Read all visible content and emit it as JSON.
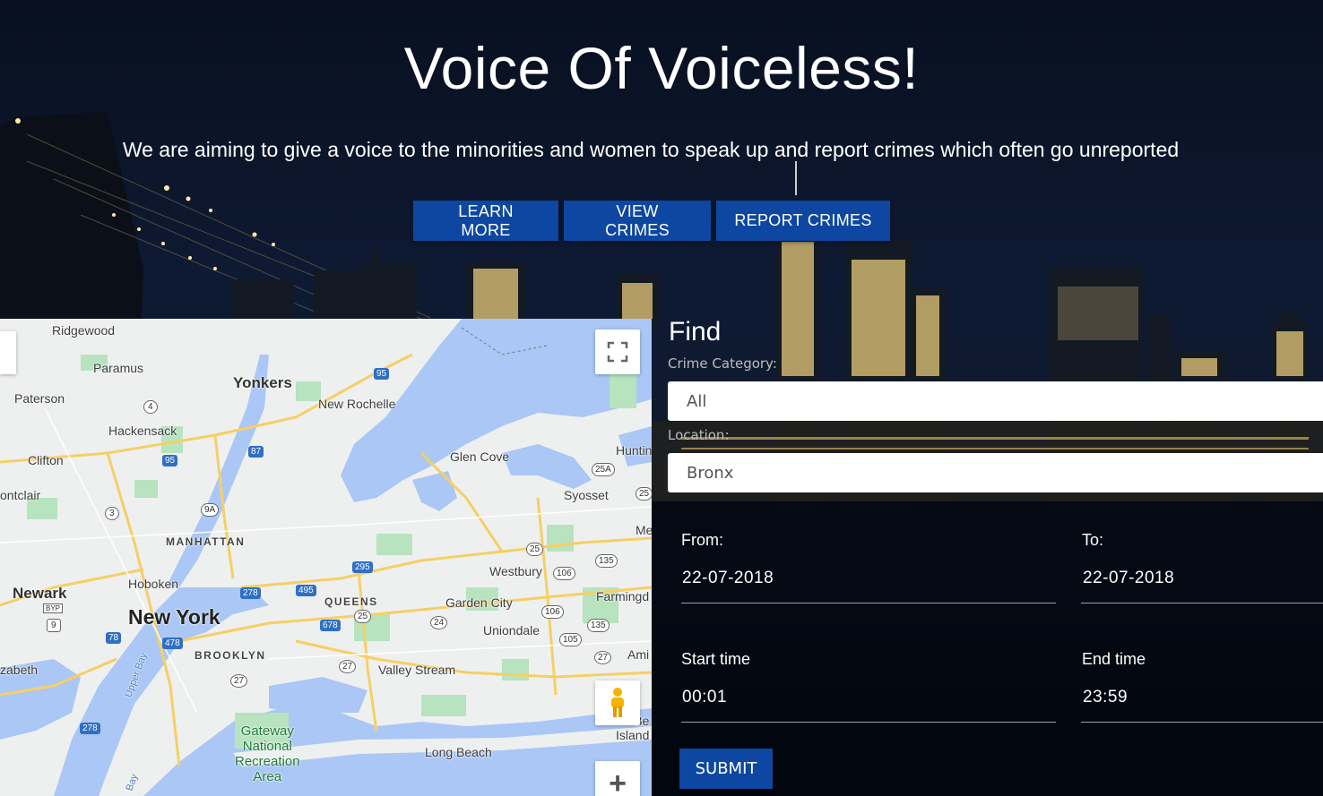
{
  "hero": {
    "title": "Voice Of Voiceless!",
    "subtitle": "We are aiming to give a voice to the minorities and women to speak up and report crimes which often go unreported",
    "buttons": {
      "learn_more": "LEARN MORE",
      "view_crimes": "VIEW CRIMES",
      "report_crimes": "REPORT CRIMES"
    },
    "button_color": "#0d47a1"
  },
  "map": {
    "labels": {
      "ridgewood": "Ridgewood",
      "paramus": "Paramus",
      "yonkers": "Yonkers",
      "paterson": "Paterson",
      "new_rochelle": "New Rochelle",
      "hackensack": "Hackensack",
      "clifton": "Clifton",
      "glen_cove": "Glen Cove",
      "huntington": "Huntin",
      "montclair": "ontclair",
      "syosset": "Syosset",
      "manhattan": "MANHATTAN",
      "westbury": "Westbury",
      "mel": "Me",
      "newark": "Newark",
      "hoboken": "Hoboken",
      "queens": "QUEENS",
      "garden_city": "Garden City",
      "farmingdale": "Farmingd",
      "new_york": "New York",
      "uniondale": "Uniondale",
      "brooklyn": "BROOKLYN",
      "elizabeth": "zabeth",
      "valley_stream": "Valley Stream",
      "amityville": "Ami",
      "upper_bay": "Upper Bay",
      "gateway": "Gateway\nNational\nRecreation\nArea",
      "long_beach": "Long Beach",
      "bay_island": "Be\nIsland",
      "bay": "Bay"
    },
    "shields": {
      "s95a": "95",
      "s4": "4",
      "s87": "87",
      "s95b": "95",
      "s25a": "25A",
      "s25": "25",
      "s3": "3",
      "s9a": "9A",
      "s25b": "25",
      "s295": "295",
      "s106a": "106",
      "s135a": "135",
      "s278a": "278",
      "s495": "495",
      "s9": "9",
      "s678": "678",
      "s25c": "25",
      "s106b": "106",
      "s24": "24",
      "s135b": "135",
      "s78": "78",
      "s478": "478",
      "s105": "105",
      "s27a": "27",
      "s27b": "27",
      "s27c": "27",
      "s278b": "278",
      "byp": "BYP"
    },
    "controls": {
      "fullscreen_icon": "fullscreen-icon",
      "pegman_icon": "pegman-icon",
      "zoom_in_icon": "zoom-in-icon"
    },
    "zoom_in_symbol": "+",
    "water_color": "#aac7f5",
    "land_color": "#eef0ef",
    "park_color": "#b7e3be",
    "road_color": "#f6cf65"
  },
  "find": {
    "title": "Find",
    "crime_category_label": "Crime Category:",
    "crime_category_value": "All",
    "location_label": "Location:",
    "location_value": "Bronx",
    "from_label": "From:",
    "from_value": "22-07-2018",
    "to_label": "To:",
    "to_value": "22-07-2018",
    "start_time_label": "Start time",
    "start_time_value": "00:01",
    "end_time_label": "End time",
    "end_time_value": "23:59",
    "submit_label": "SUBMIT"
  }
}
